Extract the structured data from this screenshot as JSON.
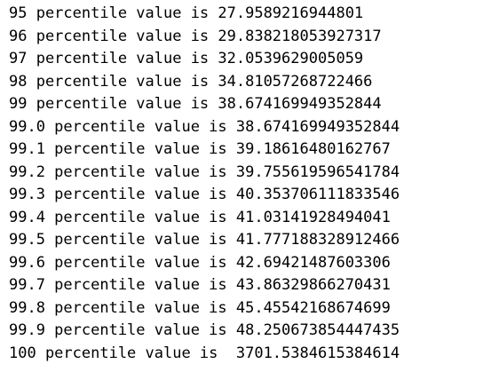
{
  "output": {
    "lines": [
      "95 percentile value is 27.9589216944801",
      "96 percentile value is 29.838218053927317",
      "97 percentile value is 32.0539629005059",
      "98 percentile value is 34.81057268722466",
      "99 percentile value is 38.674169949352844",
      "99.0 percentile value is 38.674169949352844",
      "99.1 percentile value is 39.18616480162767",
      "99.2 percentile value is 39.755619596541784",
      "99.3 percentile value is 40.353706111833546",
      "99.4 percentile value is 41.03141928494041",
      "99.5 percentile value is 41.777188328912466",
      "99.6 percentile value is 42.69421487603306",
      "99.7 percentile value is 43.86329866270431",
      "99.8 percentile value is 45.45542168674699",
      "99.9 percentile value is 48.250673854447435",
      "100 percentile value is  3701.5384615384614"
    ]
  }
}
